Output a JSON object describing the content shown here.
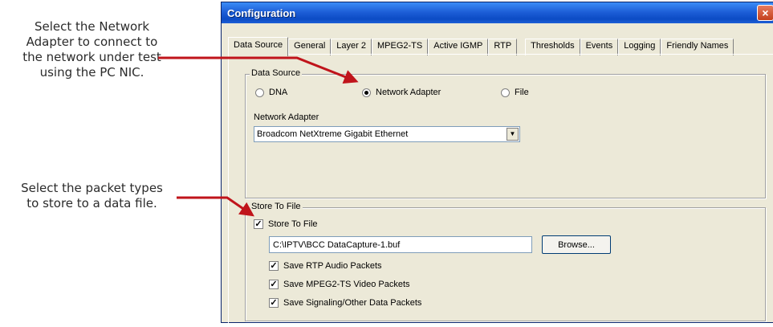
{
  "callouts": {
    "network_adapter": [
      "Select the Network",
      "Adapter to connect to",
      "the network under test",
      "using the PC NIC."
    ],
    "store_to_file": [
      "Select the packet types",
      "to store to a data file."
    ]
  },
  "colors": {
    "arrow": "#c0141b",
    "titlebar": "#0c4bc4"
  },
  "window": {
    "title": "Configuration",
    "close_icon": "×",
    "tabs": [
      "Data Source",
      "General",
      "Layer 2",
      "MPEG2-TS",
      "Active IGMP",
      "RTP",
      "Thresholds",
      "Events",
      "Logging",
      "Friendly Names"
    ],
    "active_tab": "Data Source"
  },
  "data_source": {
    "group_label": "Data Source",
    "options": [
      {
        "label": "DNA",
        "selected": false
      },
      {
        "label": "Network Adapter",
        "selected": true
      },
      {
        "label": "File",
        "selected": false
      }
    ],
    "adapter_label": "Network Adapter",
    "adapter_value": "Broadcom NetXtreme Gigabit Ethernet"
  },
  "store_to_file": {
    "group_label": "Store To File",
    "enable_label": "Store To File",
    "enabled": true,
    "path": "C:\\IPTV\\BCC DataCapture-1.buf",
    "browse_label": "Browse...",
    "packet_types": [
      {
        "label": "Save RTP Audio Packets",
        "checked": true
      },
      {
        "label": "Save MPEG2-TS Video Packets",
        "checked": true
      },
      {
        "label": "Save Signaling/Other Data Packets",
        "checked": true
      }
    ]
  }
}
